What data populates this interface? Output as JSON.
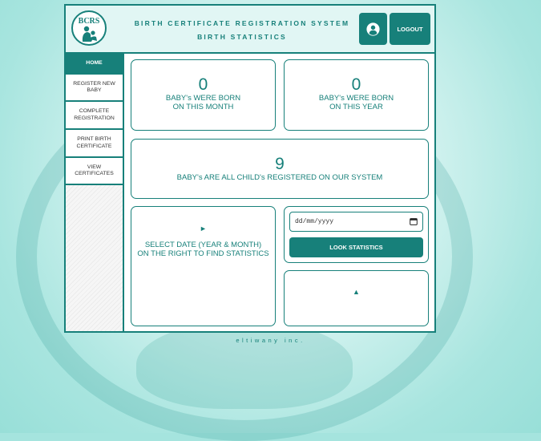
{
  "header": {
    "logo_text": "BCRS",
    "title_line1": "BIRTH CERTIFICATE REGISTRATION SYSTEM",
    "title_line2": "BIRTH STATISTICS",
    "logout_label": "LOGOUT",
    "user_icon": "user-icon"
  },
  "sidebar": {
    "items": [
      {
        "label": "HOME",
        "active": true
      },
      {
        "label": "REGISTER NEW BABY"
      },
      {
        "label": "COMPLETE REGISTRATION"
      },
      {
        "label": "PRINT BIRTH CERTIFICATE"
      },
      {
        "label": "VIEW CERTIFICATES"
      }
    ]
  },
  "stats": {
    "month": {
      "value": "0",
      "label_line1": "BABY's WERE BORN",
      "label_line2": "ON THIS MONTH"
    },
    "year": {
      "value": "0",
      "label_line1": "BABY's WERE BORN",
      "label_line2": "ON THIS YEAR"
    },
    "total": {
      "value": "9",
      "label": "BABY's ARE ALL CHILD's REGISTERED ON OUR SYSTEM"
    }
  },
  "statistics_panel": {
    "hint_arrow": "►",
    "hint_line1": "SELECT DATE (YEAR & MONTH)",
    "hint_line2": "ON THE RIGHT TO FIND STATISTICS",
    "date_placeholder": "dd/mm/yyyy",
    "look_button": "LOOK STATISTICS",
    "result_arrow": "▲"
  },
  "footer": {
    "text": "eltiwany inc."
  },
  "colors": {
    "accent": "#17807a",
    "header_bg": "#e1f6f4"
  }
}
